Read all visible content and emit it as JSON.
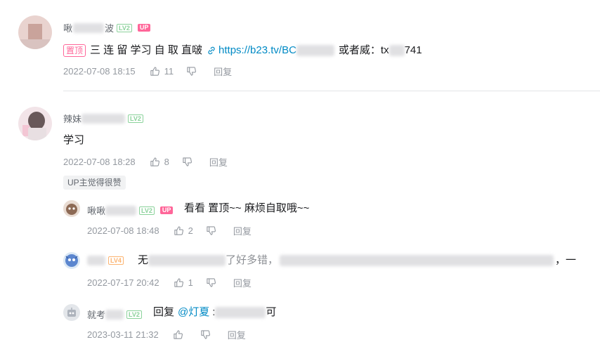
{
  "colors": {
    "accent": "#008ac5",
    "pink": "#ff6699",
    "lv2": "#8bd29b",
    "lv4": "#fcb471",
    "muted": "#9499a0"
  },
  "comments": [
    {
      "name_start": "啾",
      "name_end": "波",
      "level": "LV2",
      "up_badge": "UP",
      "pin_label": "置顶",
      "text": "三 连 留 学习 自 取 直啵",
      "link": "https://b23.tv/BC",
      "link_icon": "link-icon",
      "text_after": "或者威：tx",
      "text_tail": "741",
      "time": "2022-07-08 18:15",
      "likes": "11",
      "reply_label": "回复"
    },
    {
      "name_start": "辣妹",
      "level": "LV2",
      "text": "学习",
      "time": "2022-07-08 18:28",
      "likes": "8",
      "reply_label": "回复",
      "up_liked": "UP主觉得很赞",
      "replies": [
        {
          "name_start": "啾啾",
          "level": "LV2",
          "up_badge": "UP",
          "text": "看看 置顶~~ 麻烦自取哦~~",
          "time": "2022-07-08 18:48",
          "likes": "2",
          "reply_label": "回复"
        },
        {
          "level": "LV4",
          "text_start": "无",
          "text_mid": "了好多错，",
          "text_end": "，一",
          "time": "2022-07-17 20:42",
          "likes": "1",
          "reply_label": "回复"
        },
        {
          "name_start": "就考",
          "level": "LV2",
          "reply_prefix": "回复",
          "mention": "@灯夏",
          "text_colon": ":",
          "text_end": "可",
          "time": "2023-03-11 21:32",
          "likes": "",
          "reply_label": "回复"
        }
      ]
    }
  ]
}
